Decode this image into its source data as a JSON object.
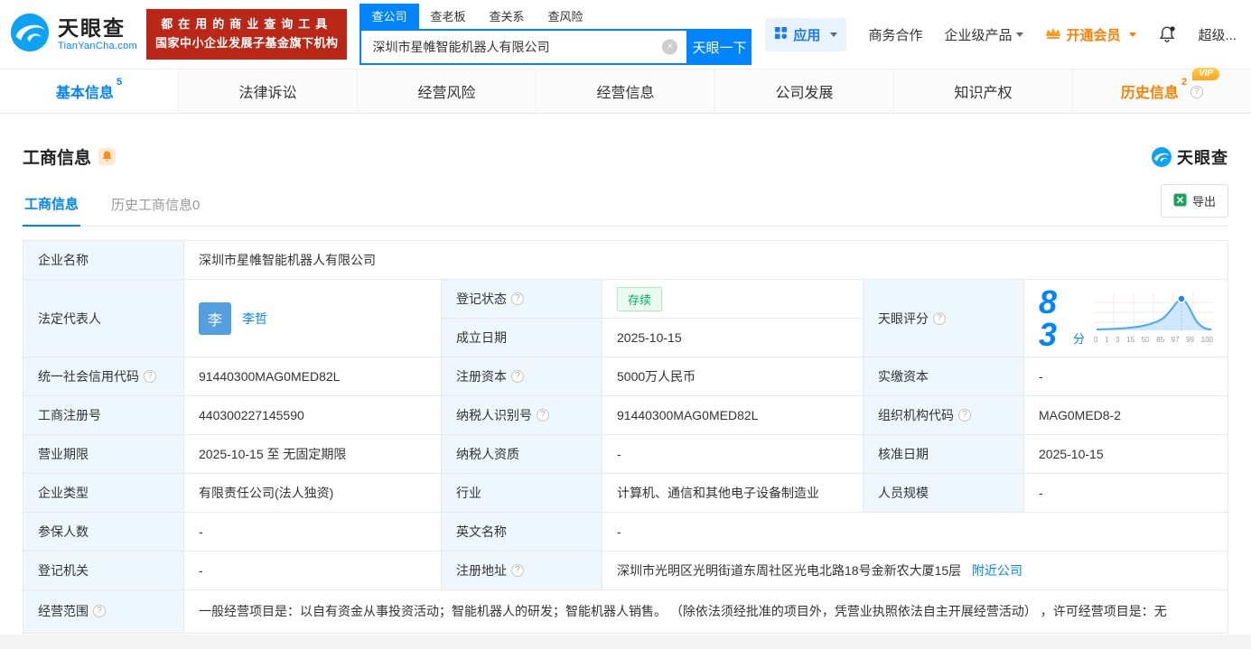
{
  "icons": {
    "help": "?",
    "clear": "×",
    "super": "超级..."
  },
  "header": {
    "brand": "天眼查",
    "brand_domain": "TianYanCha.com",
    "promo_line1": "都在用的商业查询工具",
    "promo_line2": "国家中小企业发展子基金旗下机构",
    "search_tabs": [
      {
        "label": "查公司"
      },
      {
        "label": "查老板"
      },
      {
        "label": "查关系"
      },
      {
        "label": "查风险"
      }
    ],
    "search_value": "深圳市星帷智能机器人有限公司",
    "search_button": "天眼一下",
    "nav_app": "应用",
    "nav_cooperation": "商务合作",
    "nav_enterprise": "企业级产品",
    "nav_vip": "开通会员"
  },
  "tabs": [
    {
      "label": "基本信息",
      "badge": "5"
    },
    {
      "label": "法律诉讼"
    },
    {
      "label": "经营风险"
    },
    {
      "label": "经营信息"
    },
    {
      "label": "公司发展"
    },
    {
      "label": "知识产权"
    },
    {
      "label": "历史信息",
      "badge": "2",
      "vip": "VIP"
    }
  ],
  "section": {
    "title": "工商信息",
    "brand_mark": "天眼查",
    "subtab_active": "工商信息",
    "subtab_history": "历史工商信息0",
    "export": "导出"
  },
  "info": {
    "company_name": {
      "label": "企业名称",
      "value": "深圳市星帷智能机器人有限公司"
    },
    "legal_rep": {
      "label": "法定代表人",
      "avatar": "李",
      "value": "李哲"
    },
    "reg_status": {
      "label": "登记状态",
      "value": "存续"
    },
    "est_date": {
      "label": "成立日期",
      "value": "2025-10-15"
    },
    "score": {
      "label": "天眼评分",
      "value": "83",
      "unit": "分"
    },
    "credit_code": {
      "label": "统一社会信用代码",
      "value": "91440300MAG0MED82L"
    },
    "reg_capital": {
      "label": "注册资本",
      "value": "5000万人民币"
    },
    "paid_capital": {
      "label": "实缴资本",
      "value": "-"
    },
    "reg_number": {
      "label": "工商注册号",
      "value": "440300227145590"
    },
    "taxpayer_id": {
      "label": "纳税人识别号",
      "value": "91440300MAG0MED82L"
    },
    "org_code": {
      "label": "组织机构代码",
      "value": "MAG0MED8-2"
    },
    "business_term": {
      "label": "营业期限",
      "value": "2025-10-15 至 无固定期限"
    },
    "taxpayer_quality": {
      "label": "纳税人资质",
      "value": "-"
    },
    "approved_date": {
      "label": "核准日期",
      "value": "2025-10-15"
    },
    "company_type": {
      "label": "企业类型",
      "value": "有限责任公司(法人独资)"
    },
    "industry": {
      "label": "行业",
      "value": "计算机、通信和其他电子设备制造业"
    },
    "staff_size": {
      "label": "人员规模",
      "value": "-"
    },
    "insured_count": {
      "label": "参保人数",
      "value": "-"
    },
    "english_name": {
      "label": "英文名称",
      "value": "-"
    },
    "reg_authority": {
      "label": "登记机关",
      "value": "-"
    },
    "address": {
      "label": "注册地址",
      "value": "深圳市光明区光明街道东周社区光电北路18号金新农大厦15层",
      "link": "附近公司"
    },
    "scope": {
      "label": "经营范围",
      "value": "一般经营项目是：以自有资金从事投资活动；智能机器人的研发；智能机器人销售。 （除依法须经批准的项目外，凭营业执照依法自主开展经营活动） ，许可经营项目是：无"
    }
  },
  "score_chart": {
    "ticks": [
      "0",
      "1",
      "3",
      "15",
      "50",
      "85",
      "97",
      "99",
      "100"
    ]
  }
}
